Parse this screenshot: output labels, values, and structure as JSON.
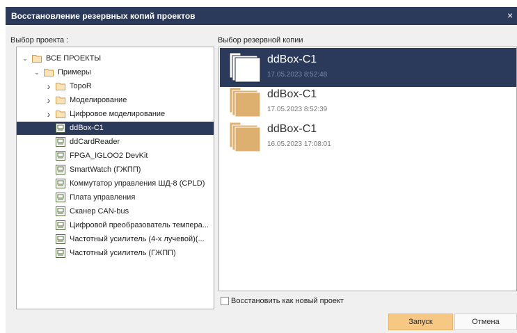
{
  "dialog": {
    "title": "Восстановление резервных копий проектов",
    "close_glyph": "×"
  },
  "left": {
    "label": "Выбор проекта :",
    "tree": [
      {
        "label": "ВСЕ ПРОЕКТЫ",
        "icon": "folder-icon",
        "expander": "expanded"
      },
      {
        "label": "Примеры",
        "icon": "folder-icon",
        "expander": "expanded"
      },
      {
        "label": "TopoR",
        "icon": "folder-icon",
        "expander": "collapsed"
      },
      {
        "label": "Моделирование",
        "icon": "folder-icon",
        "expander": "collapsed"
      },
      {
        "label": "Цифровое моделирование",
        "icon": "folder-icon",
        "expander": "collapsed"
      },
      {
        "label": "ddBox-C1",
        "icon": "project-icon",
        "selected": true
      },
      {
        "label": "ddCardReader",
        "icon": "project-icon"
      },
      {
        "label": "FPGA_IGLOO2 DevKit",
        "icon": "project-icon"
      },
      {
        "label": "SmartWatch (ГЖПП)",
        "icon": "project-icon"
      },
      {
        "label": "Коммутатор управления ШД-8 (CPLD)",
        "icon": "project-icon"
      },
      {
        "label": "Плата управления",
        "icon": "project-icon"
      },
      {
        "label": "Сканер CAN-bus",
        "icon": "project-icon"
      },
      {
        "label": "Цифровой преобразователь темпера...",
        "icon": "project-icon"
      },
      {
        "label": "Частотный усилитель (4-х лучевой)(...",
        "icon": "project-icon"
      },
      {
        "label": "Частотный усилитель (ГЖПП)",
        "icon": "project-icon"
      }
    ]
  },
  "right": {
    "label": "Выбор резервной копии",
    "backups": [
      {
        "name": "ddBox-C1",
        "date": "17.05.2023 8:52:48",
        "selected": true
      },
      {
        "name": "ddBox-C1",
        "date": "17.05.2023 8:52:39"
      },
      {
        "name": "ddBox-C1",
        "date": "16.05.2023 17:08:01"
      }
    ]
  },
  "restore_as_new": {
    "label": "Восстановить как новый проект",
    "checked": false
  },
  "buttons": {
    "run": "Запуск",
    "cancel": "Отмена"
  },
  "colors": {
    "titlebar": "#2b3a5b",
    "selection": "#2b3a5b",
    "folder": "#f2ca8c",
    "backup_folder": "#ddb06f",
    "primary_button": "#f7c883"
  }
}
